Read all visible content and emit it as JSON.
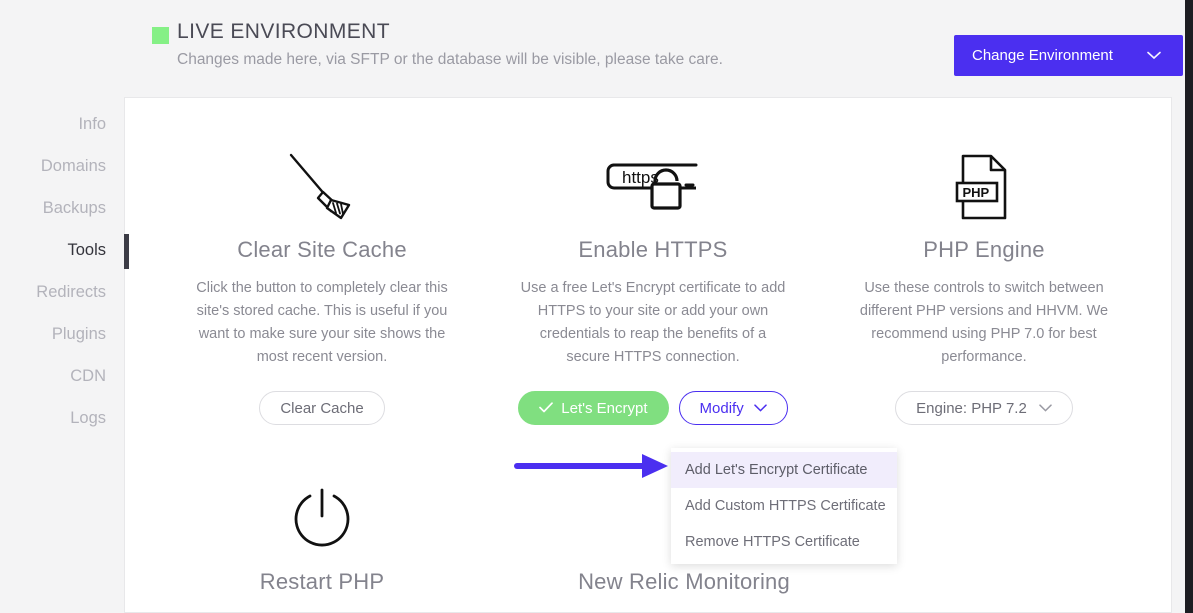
{
  "header": {
    "env_badge_color": "#85f086",
    "env_title": "LIVE ENVIRONMENT",
    "env_subtitle": "Changes made here, via SFTP or the database will be visible, please take care.",
    "change_env_label": "Change Environment",
    "change_env_caret": "chevron-down",
    "change_env_color": "#4b2ff0"
  },
  "sidebar": {
    "items": [
      {
        "label": "Info",
        "active": false
      },
      {
        "label": "Domains",
        "active": false
      },
      {
        "label": "Backups",
        "active": false
      },
      {
        "label": "Tools",
        "active": true
      },
      {
        "label": "Redirects",
        "active": false
      },
      {
        "label": "Plugins",
        "active": false
      },
      {
        "label": "CDN",
        "active": false
      },
      {
        "label": "Logs",
        "active": false
      }
    ]
  },
  "tools": [
    {
      "icon": "broom-icon",
      "title": "Clear Site Cache",
      "description": "Click the button to completely clear this site's stored cache. This is useful if you want to make sure your site shows the most recent version.",
      "buttons": [
        {
          "label": "Clear Cache",
          "style": "outline-gray",
          "name": "clear-cache-button"
        }
      ]
    },
    {
      "icon": "https-padlock-icon",
      "icon_text": "https",
      "title": "Enable HTTPS",
      "description": "Use a free Let's Encrypt certificate to add HTTPS to your site or add your own credentials to reap the benefits of a secure HTTPS connection.",
      "buttons": [
        {
          "label": "Let's Encrypt",
          "style": "green",
          "name": "lets-encrypt-button",
          "check": "✓"
        },
        {
          "label": "Modify",
          "style": "outline-purple",
          "name": "modify-https-button",
          "caret": "⌄"
        }
      ]
    },
    {
      "icon": "php-file-icon",
      "icon_text": "PHP",
      "title": "PHP Engine",
      "description": "Use these controls to switch between different PHP versions and HHVM. We recommend using PHP 7.0 for best performance.",
      "buttons": [
        {
          "label": "Engine: PHP 7.2",
          "style": "outline-gray",
          "name": "php-engine-select",
          "caret": "⌄"
        }
      ]
    },
    {
      "icon": "power-icon",
      "title": "Restart PHP",
      "description": "",
      "buttons": []
    },
    {
      "icon": "new-relic-icon",
      "title": "New Relic Monitoring",
      "description": "",
      "buttons": []
    }
  ],
  "dropdown": {
    "items": [
      {
        "label": "Add Let's Encrypt Certificate",
        "highlighted": true
      },
      {
        "label": "Add Custom HTTPS Certificate",
        "highlighted": false
      },
      {
        "label": "Remove HTTPS Certificate",
        "highlighted": false
      }
    ],
    "highlight_color": "#f1edfc"
  },
  "annotation": {
    "arrow_color": "#4b2ff0",
    "points_to": "Add Let's Encrypt Certificate"
  }
}
